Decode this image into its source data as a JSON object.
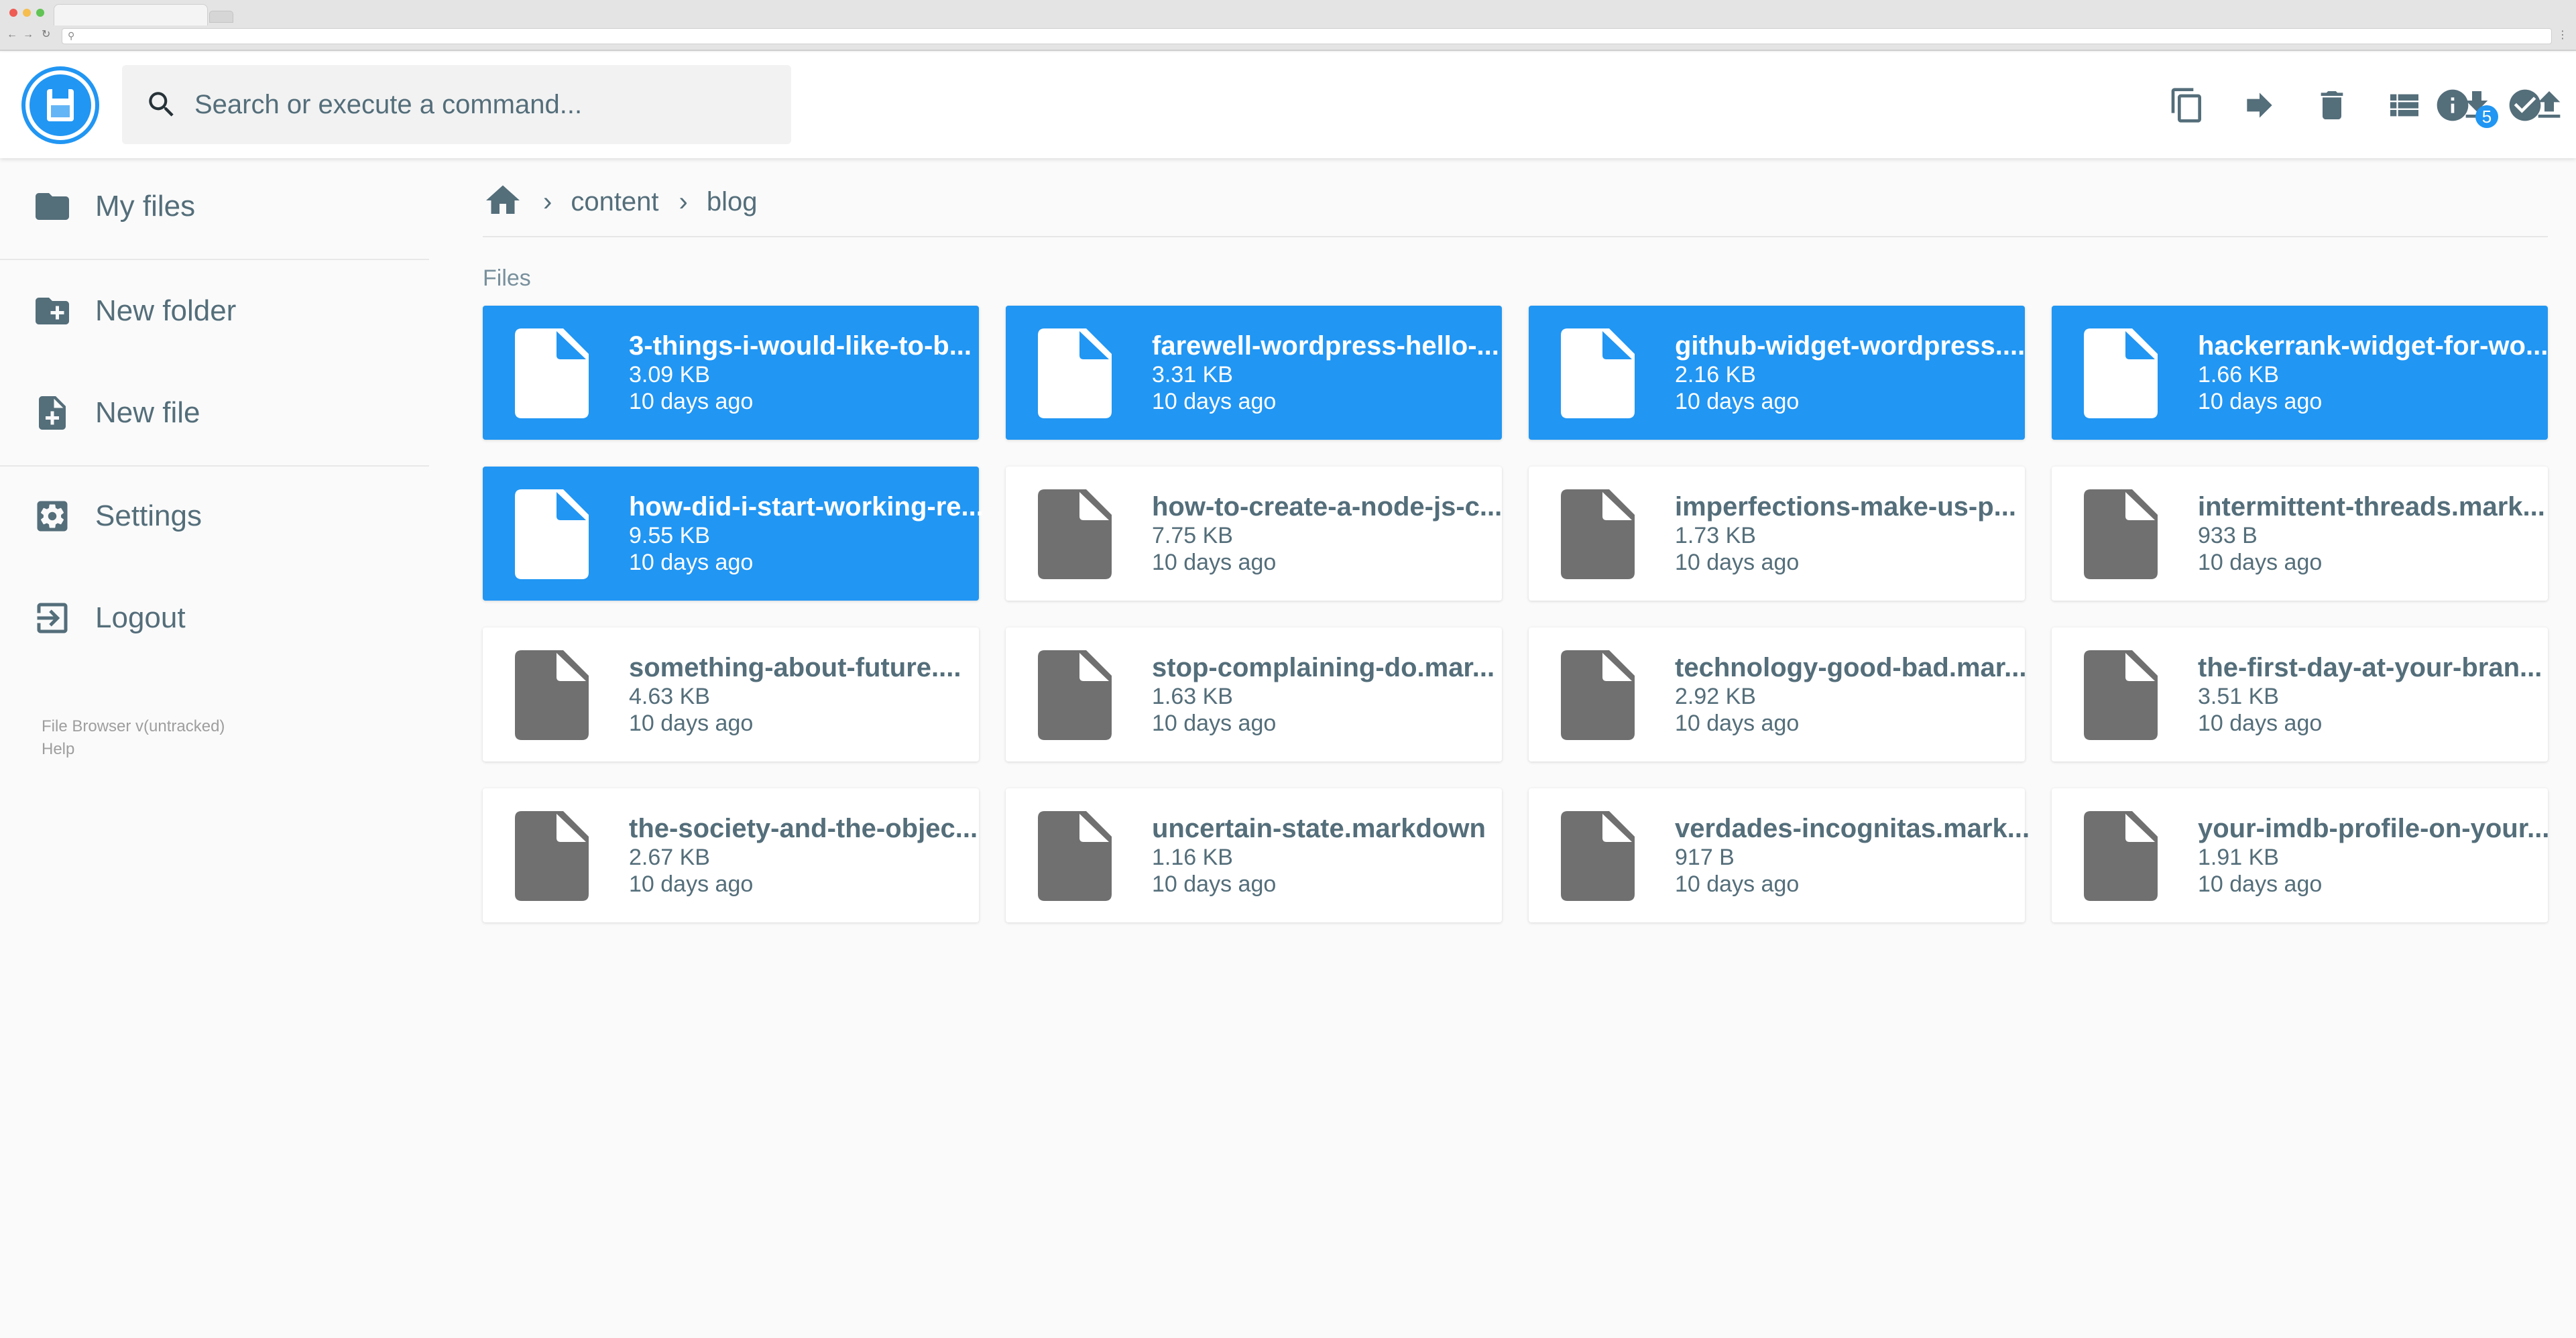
{
  "app": {
    "search_placeholder": "Search or execute a command...",
    "download_badge": "5",
    "accent_color": "#2196f3"
  },
  "sidebar": {
    "items": [
      {
        "label": "My files",
        "icon": "folder-icon"
      },
      {
        "label": "New folder",
        "icon": "create-new-folder-icon"
      },
      {
        "label": "New file",
        "icon": "note-add-icon"
      },
      {
        "label": "Settings",
        "icon": "settings-icon"
      },
      {
        "label": "Logout",
        "icon": "exit-to-app-icon"
      }
    ],
    "credits": {
      "version": "File Browser v(untracked)",
      "help": "Help"
    }
  },
  "toolbar": {
    "actions": [
      "copy-icon",
      "move-icon",
      "delete-icon",
      "list-view-icon",
      "download-icon",
      "upload-icon",
      "info-icon",
      "select-check-icon"
    ]
  },
  "breadcrumb": {
    "items": [
      "content",
      "blog"
    ]
  },
  "files": {
    "section_title": "Files",
    "items": [
      {
        "name": "3-things-i-would-like-to-b...",
        "size": "3.09 KB",
        "modified": "10 days ago",
        "selected": true
      },
      {
        "name": "farewell-wordpress-hello-...",
        "size": "3.31 KB",
        "modified": "10 days ago",
        "selected": true
      },
      {
        "name": "github-widget-wordpress....",
        "size": "2.16 KB",
        "modified": "10 days ago",
        "selected": true
      },
      {
        "name": "hackerrank-widget-for-wo...",
        "size": "1.66 KB",
        "modified": "10 days ago",
        "selected": true
      },
      {
        "name": "how-did-i-start-working-re...",
        "size": "9.55 KB",
        "modified": "10 days ago",
        "selected": true
      },
      {
        "name": "how-to-create-a-node-js-c...",
        "size": "7.75 KB",
        "modified": "10 days ago",
        "selected": false
      },
      {
        "name": "imperfections-make-us-p...",
        "size": "1.73 KB",
        "modified": "10 days ago",
        "selected": false
      },
      {
        "name": "intermittent-threads.mark...",
        "size": "933 B",
        "modified": "10 days ago",
        "selected": false
      },
      {
        "name": "something-about-future....",
        "size": "4.63 KB",
        "modified": "10 days ago",
        "selected": false
      },
      {
        "name": "stop-complaining-do.mar...",
        "size": "1.63 KB",
        "modified": "10 days ago",
        "selected": false
      },
      {
        "name": "technology-good-bad.mar...",
        "size": "2.92 KB",
        "modified": "10 days ago",
        "selected": false
      },
      {
        "name": "the-first-day-at-your-bran...",
        "size": "3.51 KB",
        "modified": "10 days ago",
        "selected": false
      },
      {
        "name": "the-society-and-the-objec...",
        "size": "2.67 KB",
        "modified": "10 days ago",
        "selected": false
      },
      {
        "name": "uncertain-state.markdown",
        "size": "1.16 KB",
        "modified": "10 days ago",
        "selected": false
      },
      {
        "name": "verdades-incognitas.mark...",
        "size": "917 B",
        "modified": "10 days ago",
        "selected": false
      },
      {
        "name": "your-imdb-profile-on-your...",
        "size": "1.91 KB",
        "modified": "10 days ago",
        "selected": false
      }
    ]
  }
}
